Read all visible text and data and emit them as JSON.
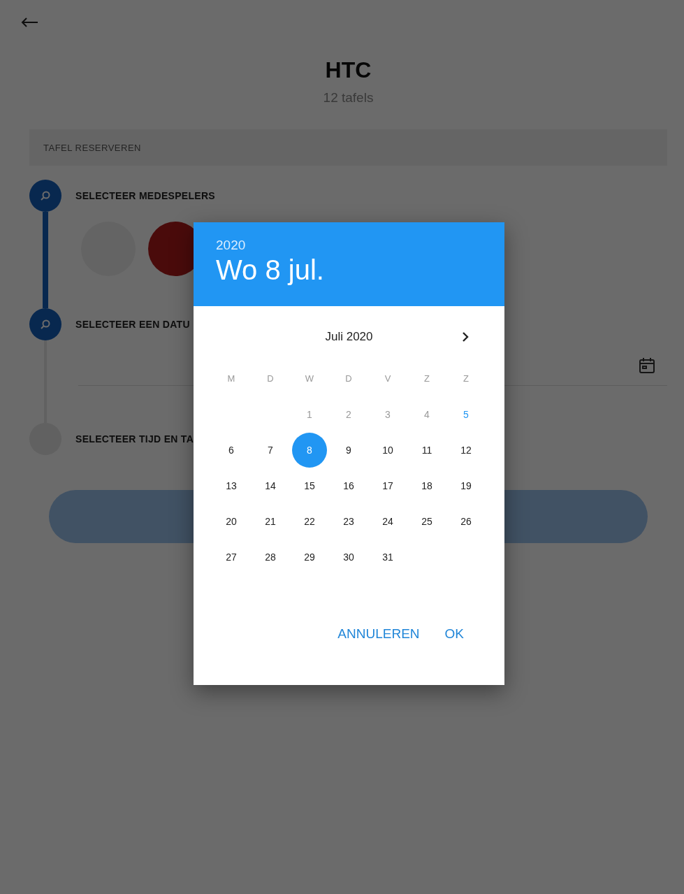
{
  "page": {
    "title": "HTC",
    "subtitle": "12 tafels"
  },
  "section": {
    "label": "TAFEL RESERVEREN"
  },
  "steps": [
    {
      "label": "SELECTEER MEDESPELERS",
      "active": true,
      "kind": "players"
    },
    {
      "label": "SELECTEER EEN DATU",
      "active": true,
      "kind": "date"
    },
    {
      "label": "SELECTEER TIJD EN TA",
      "active": false,
      "kind": "plain"
    }
  ],
  "dialog": {
    "year": "2020",
    "date": "Wo 8 jul.",
    "month": "Juli 2020",
    "weekdays": [
      "M",
      "D",
      "W",
      "D",
      "V",
      "Z",
      "Z"
    ],
    "days": [
      {
        "label": "1",
        "disabled": true,
        "today": false,
        "selected": false
      },
      {
        "label": "2",
        "disabled": true,
        "today": false,
        "selected": false
      },
      {
        "label": "3",
        "disabled": true,
        "today": false,
        "selected": false
      },
      {
        "label": "4",
        "disabled": true,
        "today": false,
        "selected": false
      },
      {
        "label": "5",
        "disabled": false,
        "today": true,
        "selected": false
      },
      {
        "label": "6",
        "disabled": false,
        "today": false,
        "selected": false
      },
      {
        "label": "7",
        "disabled": false,
        "today": false,
        "selected": false
      },
      {
        "label": "8",
        "disabled": false,
        "today": false,
        "selected": true
      },
      {
        "label": "9",
        "disabled": false,
        "today": false,
        "selected": false
      },
      {
        "label": "10",
        "disabled": false,
        "today": false,
        "selected": false
      },
      {
        "label": "11",
        "disabled": false,
        "today": false,
        "selected": false
      },
      {
        "label": "12",
        "disabled": false,
        "today": false,
        "selected": false
      },
      {
        "label": "13",
        "disabled": false,
        "today": false,
        "selected": false
      },
      {
        "label": "14",
        "disabled": false,
        "today": false,
        "selected": false
      },
      {
        "label": "15",
        "disabled": false,
        "today": false,
        "selected": false
      },
      {
        "label": "16",
        "disabled": false,
        "today": false,
        "selected": false
      },
      {
        "label": "17",
        "disabled": false,
        "today": false,
        "selected": false
      },
      {
        "label": "18",
        "disabled": false,
        "today": false,
        "selected": false
      },
      {
        "label": "19",
        "disabled": false,
        "today": false,
        "selected": false
      },
      {
        "label": "20",
        "disabled": false,
        "today": false,
        "selected": false
      },
      {
        "label": "21",
        "disabled": false,
        "today": false,
        "selected": false
      },
      {
        "label": "22",
        "disabled": false,
        "today": false,
        "selected": false
      },
      {
        "label": "23",
        "disabled": false,
        "today": false,
        "selected": false
      },
      {
        "label": "24",
        "disabled": false,
        "today": false,
        "selected": false
      },
      {
        "label": "25",
        "disabled": false,
        "today": false,
        "selected": false
      },
      {
        "label": "26",
        "disabled": false,
        "today": false,
        "selected": false
      },
      {
        "label": "27",
        "disabled": false,
        "today": false,
        "selected": false
      },
      {
        "label": "28",
        "disabled": false,
        "today": false,
        "selected": false
      },
      {
        "label": "29",
        "disabled": false,
        "today": false,
        "selected": false
      },
      {
        "label": "30",
        "disabled": false,
        "today": false,
        "selected": false
      },
      {
        "label": "31",
        "disabled": false,
        "today": false,
        "selected": false
      }
    ],
    "buttons": [
      {
        "label": "ANNULEREN"
      },
      {
        "label": "OK"
      }
    ]
  }
}
